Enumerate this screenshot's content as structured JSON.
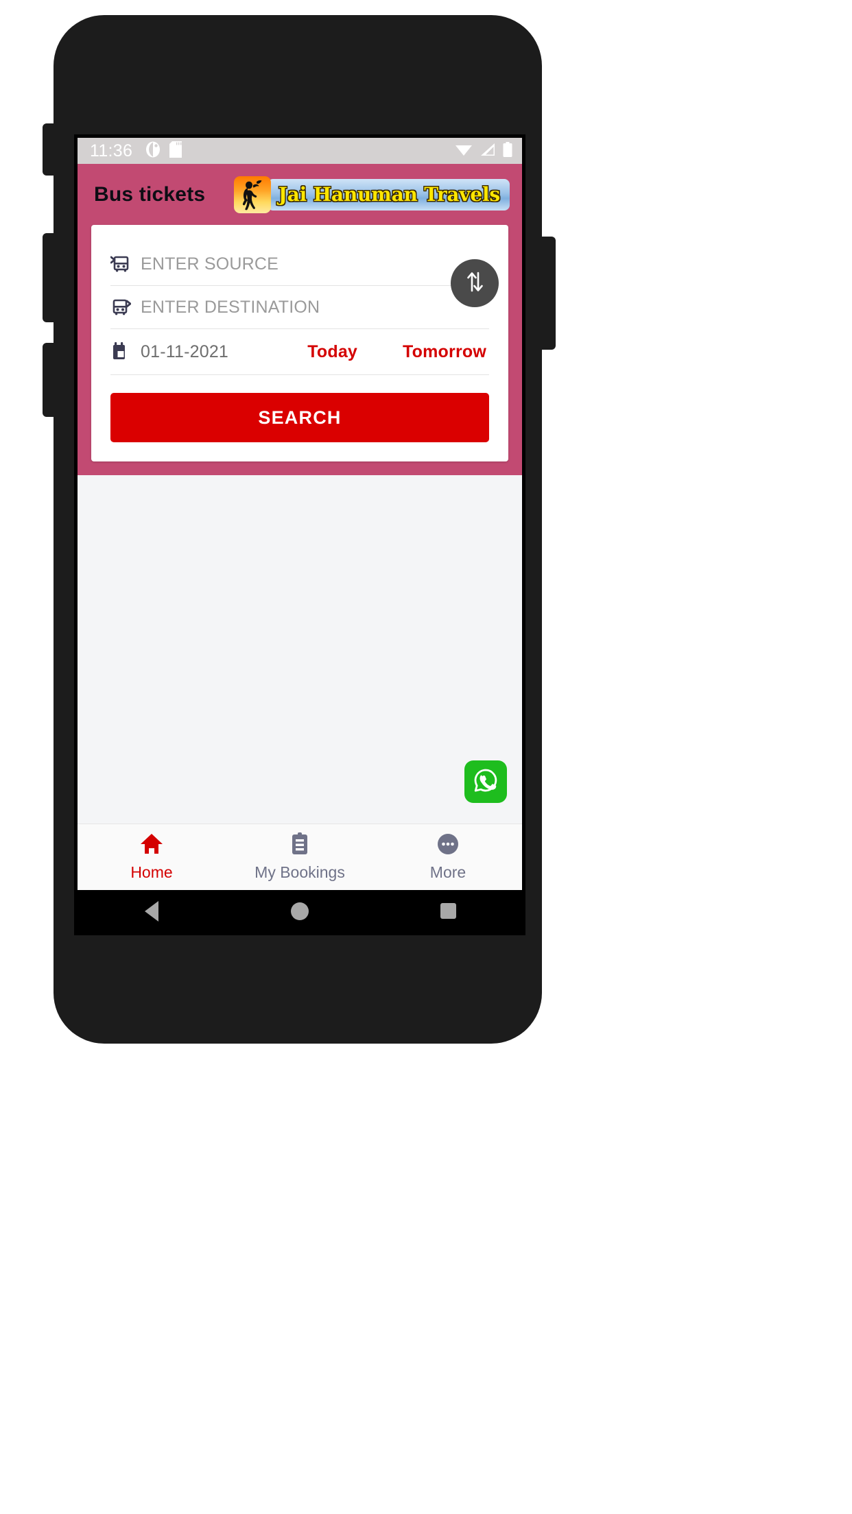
{
  "status_bar": {
    "time": "11:36",
    "icons_left": [
      "camera-icon",
      "sd-card-icon"
    ],
    "icons_right": [
      "wifi-icon",
      "cellular-signal-icon",
      "battery-icon"
    ],
    "background_color": "#d4d1d1"
  },
  "app_bar": {
    "title": "Bus tickets",
    "background_color": "#c24a72",
    "logo": {
      "badge_icon": "hanuman-deity-icon",
      "text": "Jai Hanuman Travels",
      "text_color": "#ffe600"
    }
  },
  "search_card": {
    "source": {
      "icon": "bus-arrival-icon",
      "placeholder": "ENTER SOURCE",
      "value": ""
    },
    "destination": {
      "icon": "bus-departure-icon",
      "placeholder": "ENTER DESTINATION",
      "value": ""
    },
    "swap_button": {
      "icon": "swap-vertical-arrows-icon",
      "background_color": "#4a4a4a"
    },
    "date": {
      "icon": "calendar-icon",
      "value": "01-11-2021"
    },
    "today_label": "Today",
    "tomorrow_label": "Tomorrow",
    "quick_date_color": "#d40000",
    "search_label": "SEARCH",
    "search_color": "#da0000"
  },
  "floating_action": {
    "icon": "whatsapp-icon",
    "background_color": "#1ebd1e"
  },
  "bottom_nav": {
    "items": [
      {
        "label": "Home",
        "icon": "home-icon",
        "active": true
      },
      {
        "label": "My Bookings",
        "icon": "clipboard-icon",
        "active": false
      },
      {
        "label": "More",
        "icon": "more-dots-icon",
        "active": false
      }
    ],
    "active_color": "#d40000",
    "inactive_color": "#6f7288"
  },
  "system_nav": {
    "back": "back-triangle-icon",
    "home": "home-circle-icon",
    "recents": "recents-square-icon"
  }
}
